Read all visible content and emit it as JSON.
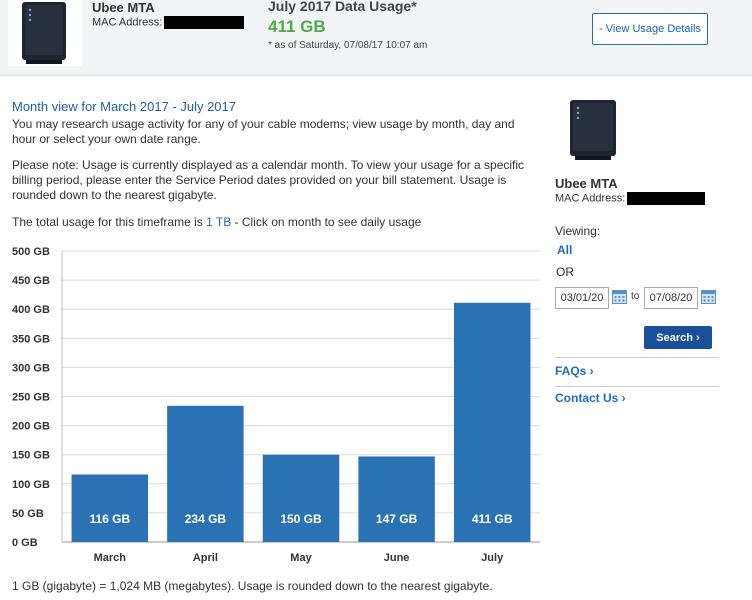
{
  "header": {
    "device_name": "Ubee MTA",
    "mac_label": "MAC Address:",
    "usage_title": "July 2017 Data Usage*",
    "usage_value": "411 GB",
    "as_of": "* as of Saturday, 07/08/17 10:07 am",
    "details_button": "- View Usage Details"
  },
  "main": {
    "title": "Month view for March 2017 - July 2017",
    "paragraph1": "You may research usage activity for any of your cable modems; view usage by month, day and hour or select your own date range.",
    "paragraph2": "Please note: Usage is currently displayed as a calendar month. To view your usage for a specific billing period, please enter the Service Period dates provided on your bill statement. Usage is rounded down to the nearest gigabyte.",
    "total_prefix": "The total usage for this timeframe is ",
    "total_value": "1 TB",
    "total_suffix": " - Click on month to see daily usage",
    "footnote": "1 GB (gigabyte) = 1,024 MB (megabytes). Usage is rounded down to the nearest gigabyte."
  },
  "sidebar": {
    "device_name": "Ubee MTA",
    "mac_label": "MAC Address:",
    "viewing_label": "Viewing:",
    "all_link": "All",
    "or_label": "OR",
    "start_date": "03/01/20",
    "to_label": "to",
    "end_date": "07/08/20",
    "search_button": "Search ›",
    "faq_link": "FAQs ›",
    "contact_link": "Contact Us ›"
  },
  "colors": {
    "bar": "#2b72b5",
    "accent_green": "#4fa94a",
    "link_blue": "#1f6cc2",
    "button_dark": "#1a4f9c"
  },
  "chart_data": {
    "type": "bar",
    "categories": [
      "March",
      "April",
      "May",
      "June",
      "July"
    ],
    "values": [
      116,
      234,
      150,
      147,
      411
    ],
    "value_labels": [
      "116 GB",
      "234 GB",
      "150 GB",
      "147 GB",
      "411 GB"
    ],
    "yticks": [
      "0 GB",
      "50 GB",
      "100 GB",
      "150 GB",
      "200 GB",
      "250 GB",
      "300 GB",
      "350 GB",
      "400 GB",
      "450 GB",
      "500 GB"
    ],
    "ylim": [
      0,
      500
    ],
    "grid": true,
    "legend": "none"
  }
}
